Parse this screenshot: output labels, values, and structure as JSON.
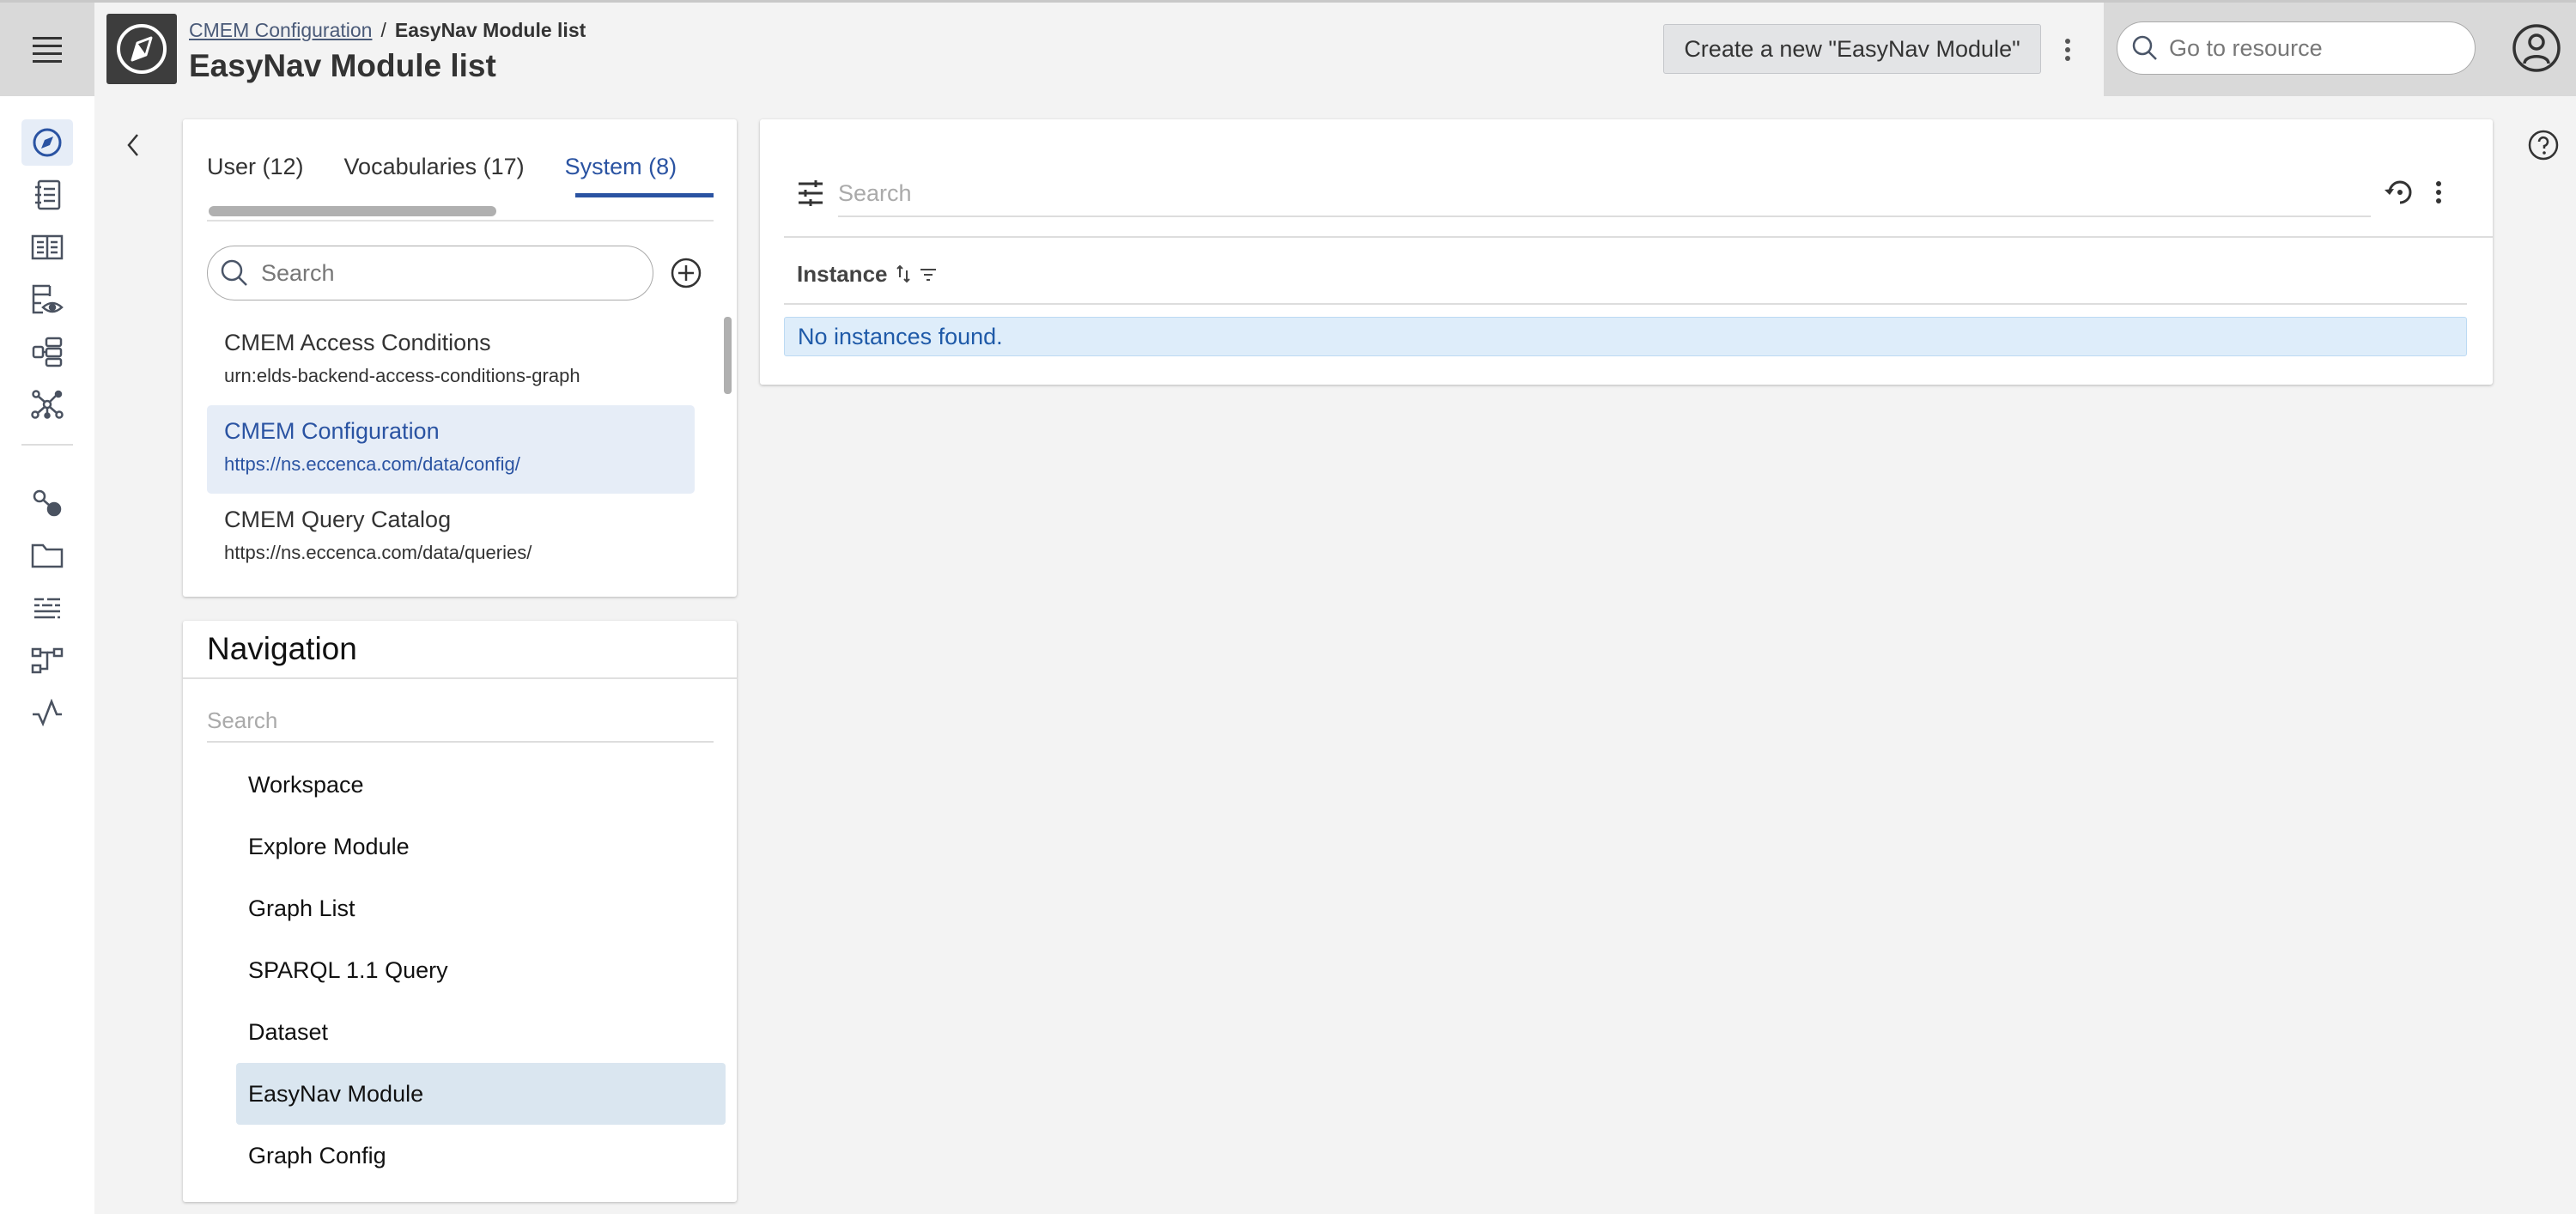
{
  "header": {
    "breadcrumb_parent": "CMEM Configuration",
    "breadcrumb_separator": "/",
    "breadcrumb_current": "EasyNav Module list",
    "title": "EasyNav Module list",
    "create_button_label": "Create a new \"EasyNav Module\"",
    "goto_placeholder": "Go to resource"
  },
  "rail": {
    "items": [
      {
        "icon": "compass-icon",
        "label": "Explore",
        "active": true
      },
      {
        "icon": "notebook-icon",
        "label": "Queries"
      },
      {
        "icon": "book-icon",
        "label": "Vocabularies"
      },
      {
        "icon": "dataset-view-icon",
        "label": "Datasets"
      },
      {
        "icon": "hierarchy-icon",
        "label": "Taxonomy"
      },
      {
        "icon": "graph-network-icon",
        "label": "Graph"
      },
      {
        "icon": "link-node-icon",
        "label": "Linking"
      },
      {
        "icon": "folder-icon",
        "label": "Projects"
      },
      {
        "icon": "text-lines-icon",
        "label": "Rules"
      },
      {
        "icon": "workflow-icon",
        "label": "Workflows"
      },
      {
        "icon": "activity-icon",
        "label": "Activities"
      }
    ]
  },
  "graph_panel": {
    "tabs": [
      {
        "label": "User (12)",
        "active": false
      },
      {
        "label": "Vocabularies (17)",
        "active": false
      },
      {
        "label": "System (8)",
        "active": true
      }
    ],
    "search_placeholder": "Search",
    "graphs": [
      {
        "title": "CMEM Access Conditions",
        "uri": "urn:elds-backend-access-conditions-graph",
        "selected": false
      },
      {
        "title": "CMEM Configuration",
        "uri": "https://ns.eccenca.com/data/config/",
        "selected": true
      },
      {
        "title": "CMEM Query Catalog",
        "uri": "https://ns.eccenca.com/data/queries/",
        "selected": false
      }
    ]
  },
  "navigation": {
    "title": "Navigation",
    "search_placeholder": "Search",
    "items": [
      {
        "label": "Workspace",
        "selected": false
      },
      {
        "label": "Explore Module",
        "selected": false
      },
      {
        "label": "Graph List",
        "selected": false
      },
      {
        "label": "SPARQL 1.1 Query",
        "selected": false
      },
      {
        "label": "Dataset",
        "selected": false
      },
      {
        "label": "EasyNav Module",
        "selected": true
      },
      {
        "label": "Graph Config",
        "selected": false
      }
    ]
  },
  "main": {
    "search_placeholder": "Search",
    "column_header": "Instance",
    "empty_message": "No instances found."
  },
  "colors": {
    "accent": "#2a53a2",
    "selected_bg": "#e6edf7",
    "info_bg": "#deedfa"
  }
}
